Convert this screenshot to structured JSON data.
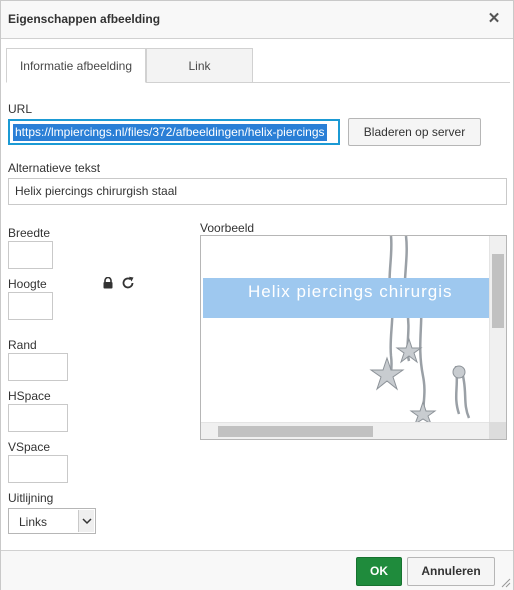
{
  "dialog": {
    "title": "Eigenschappen afbeelding",
    "close_glyph": "✕"
  },
  "tabs": [
    {
      "label": "Informatie afbeelding",
      "active": true
    },
    {
      "label": "Link",
      "active": false
    }
  ],
  "url": {
    "label": "URL",
    "value": "https://lmpiercings.nl/files/372/afbeeldingen/helix-piercings",
    "browse_button": "Bladeren op server"
  },
  "alt": {
    "label": "Alternatieve tekst",
    "value": "Helix piercings chirurgish staal"
  },
  "dimensions": {
    "width_label": "Breedte",
    "width_value": "",
    "height_label": "Hoogte",
    "height_value": "",
    "lock_icon": "lock-icon",
    "reset_icon": "reset-size-icon"
  },
  "border": {
    "label": "Rand",
    "value": ""
  },
  "hspace": {
    "label": "HSpace",
    "value": ""
  },
  "vspace": {
    "label": "VSpace",
    "value": ""
  },
  "align": {
    "label": "Uitlijning",
    "selected": "Links"
  },
  "preview": {
    "label": "Voorbeeld",
    "caption": "Helix piercings chirurgis"
  },
  "footer": {
    "ok_label": "OK",
    "cancel_label": "Annuleren"
  },
  "colors": {
    "accent_ok": "#1f8b3c",
    "focus_border": "#1b9ad4",
    "selection": "#2a7fd6",
    "preview_band": "#9ec8ef"
  }
}
